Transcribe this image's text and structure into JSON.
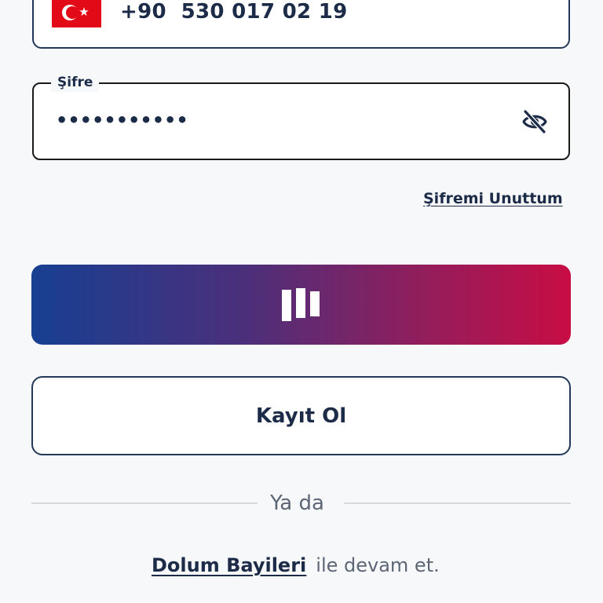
{
  "phone": {
    "flag_icon": "turkey-flag-icon",
    "country_code": "+90",
    "number": "530 017 02 19"
  },
  "password": {
    "label": "Şifre",
    "masked_value": "•••••••••••",
    "toggle_icon": "eye-off-icon"
  },
  "forgot_password": "Şifremi Unuttum",
  "login_button": {
    "icon": "brand-logo-icon",
    "gradient_start": "#173f92",
    "gradient_end": "#c80d44"
  },
  "register_button": "Kayıt Ol",
  "divider_text": "Ya da",
  "dealers": {
    "link": "Dolum Bayileri",
    "rest": "ile devam et."
  },
  "colors": {
    "text_primary": "#1c2b47",
    "text_secondary": "#5d6675",
    "background": "#f7f8f9"
  }
}
